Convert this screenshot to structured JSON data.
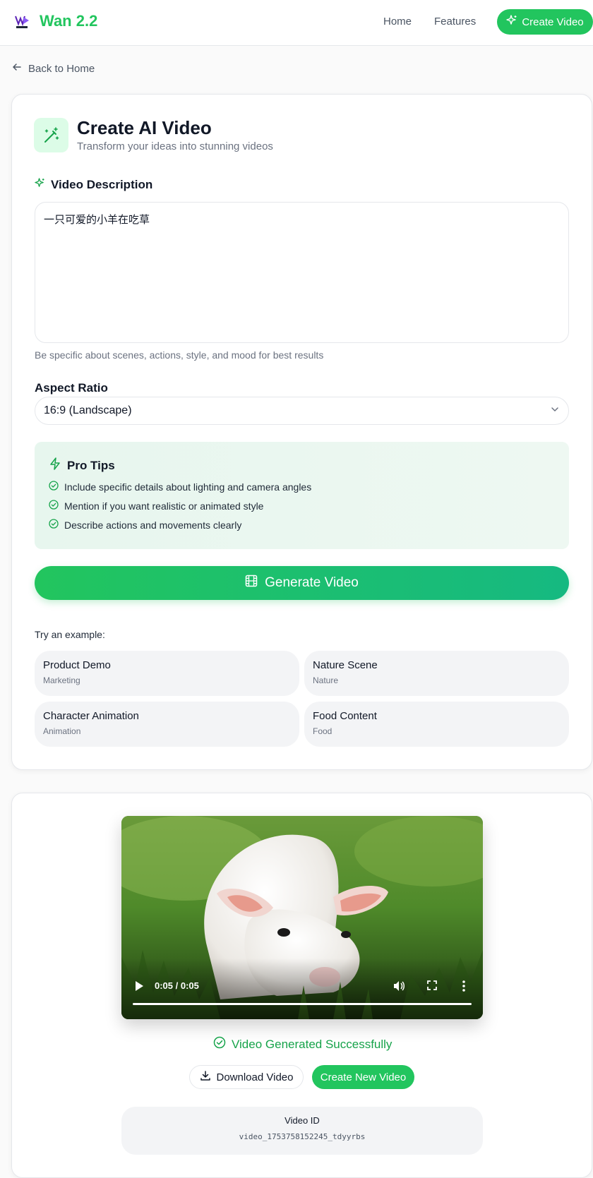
{
  "header": {
    "logo_text": "Wan 2.2",
    "nav": {
      "home": "Home",
      "features": "Features",
      "create_video": "Create Video"
    }
  },
  "back_link": "Back to Home",
  "form": {
    "title": "Create AI Video",
    "subtitle": "Transform your ideas into stunning videos",
    "description_label": "Video Description",
    "description_value": "一只可爱的小羊在吃草",
    "description_hint": "Be specific about scenes, actions, style, and mood for best results",
    "aspect_label": "Aspect Ratio",
    "aspect_value": "16:9 (Landscape)",
    "tips": {
      "title": "Pro Tips",
      "items": [
        "Include specific details about lighting and camera angles",
        "Mention if you want realistic or animated style",
        "Describe actions and movements clearly"
      ]
    },
    "generate_label": "Generate Video",
    "examples_label": "Try an example:",
    "examples": [
      {
        "title": "Product Demo",
        "tag": "Marketing"
      },
      {
        "title": "Nature Scene",
        "tag": "Nature"
      },
      {
        "title": "Character Animation",
        "tag": "Animation"
      },
      {
        "title": "Food Content",
        "tag": "Food"
      }
    ]
  },
  "result": {
    "video_time": "0:05 / 0:05",
    "video_progress": 1.0,
    "status": "Video Generated Successfully",
    "download_label": "Download Video",
    "new_label": "Create New Video",
    "id_label": "Video ID",
    "id_value": "video_1753758152245_tdyyrbs"
  },
  "colors": {
    "accent": "#22c55e",
    "tips_bg": "#e7f6ee",
    "success": "#16a34a"
  }
}
